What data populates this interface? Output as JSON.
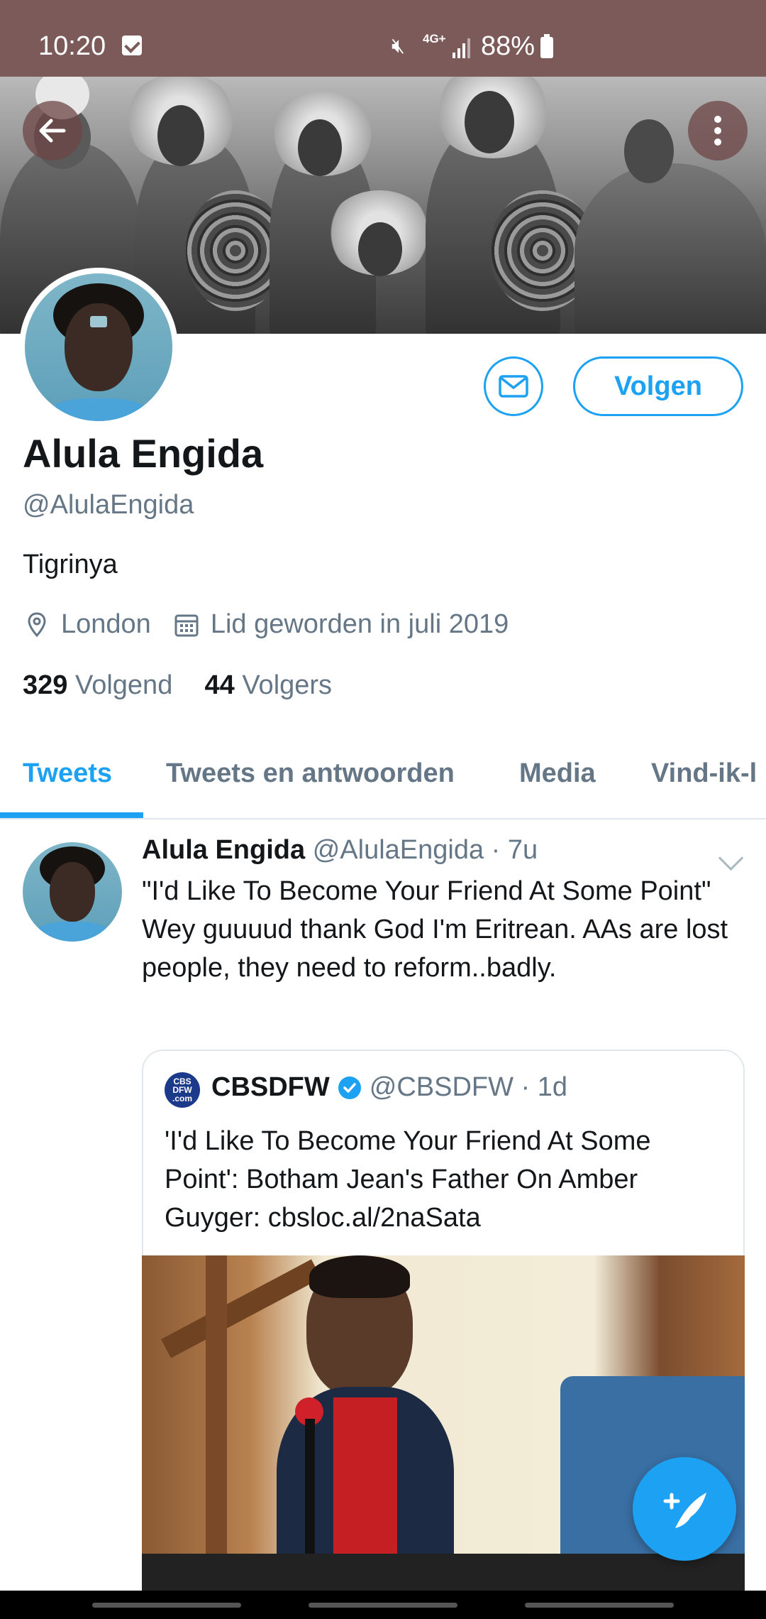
{
  "status_bar": {
    "time": "10:20",
    "network": "4G+",
    "battery": "88%"
  },
  "profile": {
    "name": "Alula Engida",
    "handle": "@AlulaEngida",
    "bio": "Tigrinya",
    "location": "London",
    "joined": "Lid geworden in juli 2019",
    "following_count": "329",
    "following_label": "Volgend",
    "followers_count": "44",
    "followers_label": "Volgers",
    "follow_label": "Volgen"
  },
  "tabs": [
    {
      "label": "Tweets"
    },
    {
      "label": "Tweets en antwoorden"
    },
    {
      "label": "Media"
    },
    {
      "label": "Vind-ik-l"
    }
  ],
  "tweet": {
    "author": "Alula Engida",
    "handle_time": "@AlulaEngida · 7u",
    "text": "\"I'd Like To Become Your Friend At Some Point\"\nWey guuuud thank God I'm Eritrean. AAs are lost people, they need to reform..badly.",
    "quoted": {
      "logo_text": "CBS DFW .com",
      "author": "CBSDFW",
      "handle_time": "@CBSDFW · 1d",
      "text": "'I'd Like To Become Your Friend At Some Point': Botham Jean's Father On Amber Guyger: cbsloc.al/2naSata"
    }
  },
  "colors": {
    "accent": "#1da1f2",
    "status_bar": "#7b5a59",
    "secondary_text": "#657786"
  }
}
